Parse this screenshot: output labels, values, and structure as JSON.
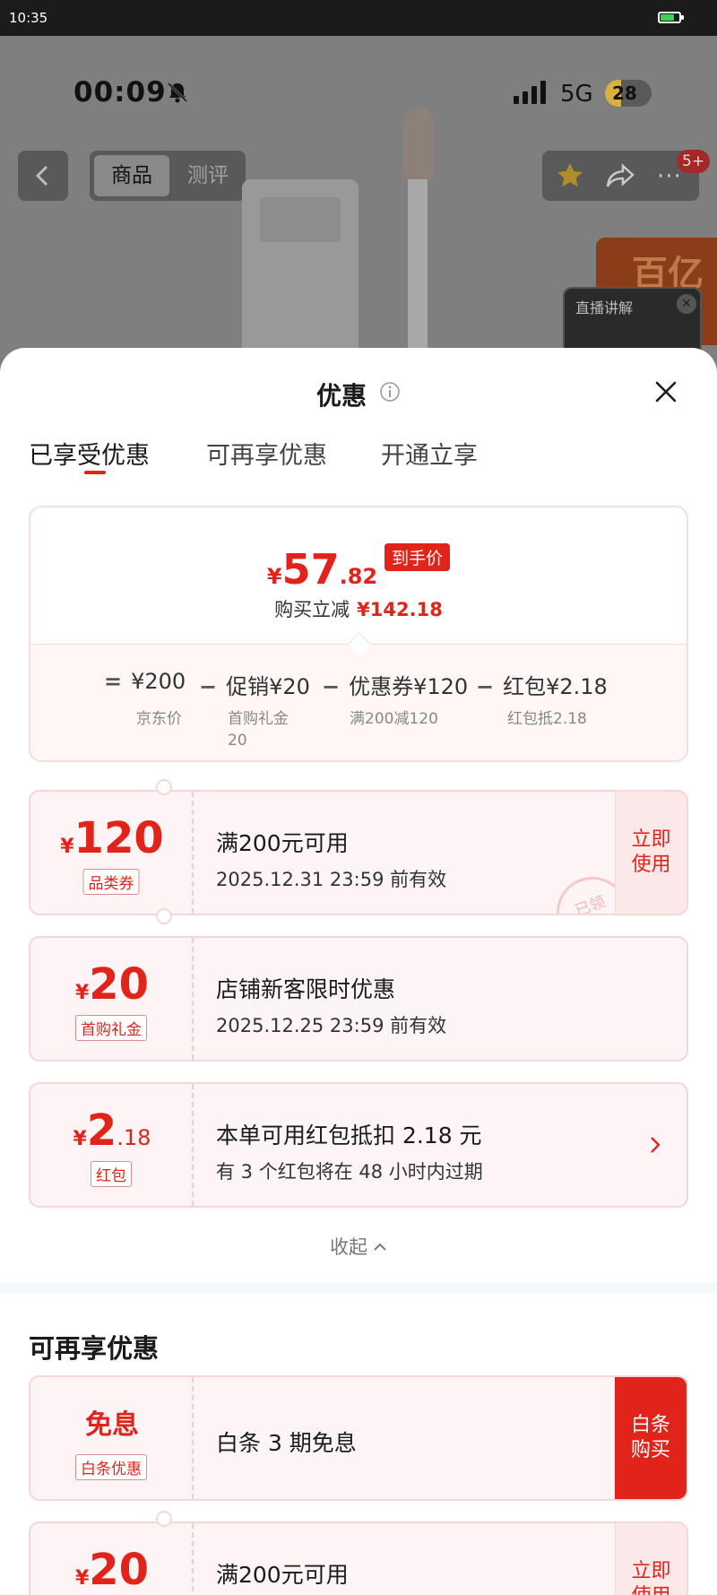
{
  "device_status": {
    "time": "10:35"
  },
  "background_page": {
    "phone_time": "00:09",
    "network": "5G",
    "battery": "28",
    "tabs": [
      "商品",
      "测评"
    ],
    "badge": "5+",
    "promo_text": "百亿",
    "live_label": "直播讲解"
  },
  "sheet": {
    "title": "优惠",
    "tabs": [
      "已享受优惠",
      "可再享优惠",
      "开通立享"
    ],
    "summary": {
      "yen": "¥",
      "price_int": "57",
      "price_dec": ".82",
      "price_tag": "到手价",
      "save_label": "购买立减",
      "save_amount": "¥142.18",
      "formula": [
        {
          "op": "=",
          "label": "¥200",
          "sub": "京东价"
        },
        {
          "op": "−",
          "label": "促销¥20",
          "sub": "首购礼金 20"
        },
        {
          "op": "−",
          "label": "优惠券¥120",
          "sub": "满200减120"
        },
        {
          "op": "−",
          "label": "红包¥2.18",
          "sub": "红包抵2.18"
        }
      ]
    },
    "coupons": [
      {
        "yen": "¥",
        "amount": "120",
        "dec": "",
        "tag": "品类券",
        "title": "满200元可用",
        "sub": "2025.12.31 23:59 前有效",
        "action": "立即使用",
        "stamp": "已领"
      },
      {
        "yen": "¥",
        "amount": "20",
        "dec": "",
        "tag": "首购礼金",
        "title": "店铺新客限时优惠",
        "sub": "2025.12.25 23:59 前有效"
      },
      {
        "yen": "¥",
        "amount": "2",
        "dec": ".18",
        "tag": "红包",
        "title": "本单可用红包抵扣 2.18 元",
        "sub": "有 3 个红包将在 48 小时内过期"
      }
    ],
    "collapse_label": "收起",
    "more_section": {
      "title": "可再享优惠",
      "items": [
        {
          "word": "免息",
          "tag": "白条优惠",
          "title": "白条 3 期免息",
          "action": "白条购买"
        },
        {
          "yen": "¥",
          "amount": "20",
          "title": "满200元可用",
          "action": "立即使用"
        }
      ]
    }
  },
  "colors": {
    "accent": "#e2231a",
    "card_bg": "#fdf5f5"
  }
}
